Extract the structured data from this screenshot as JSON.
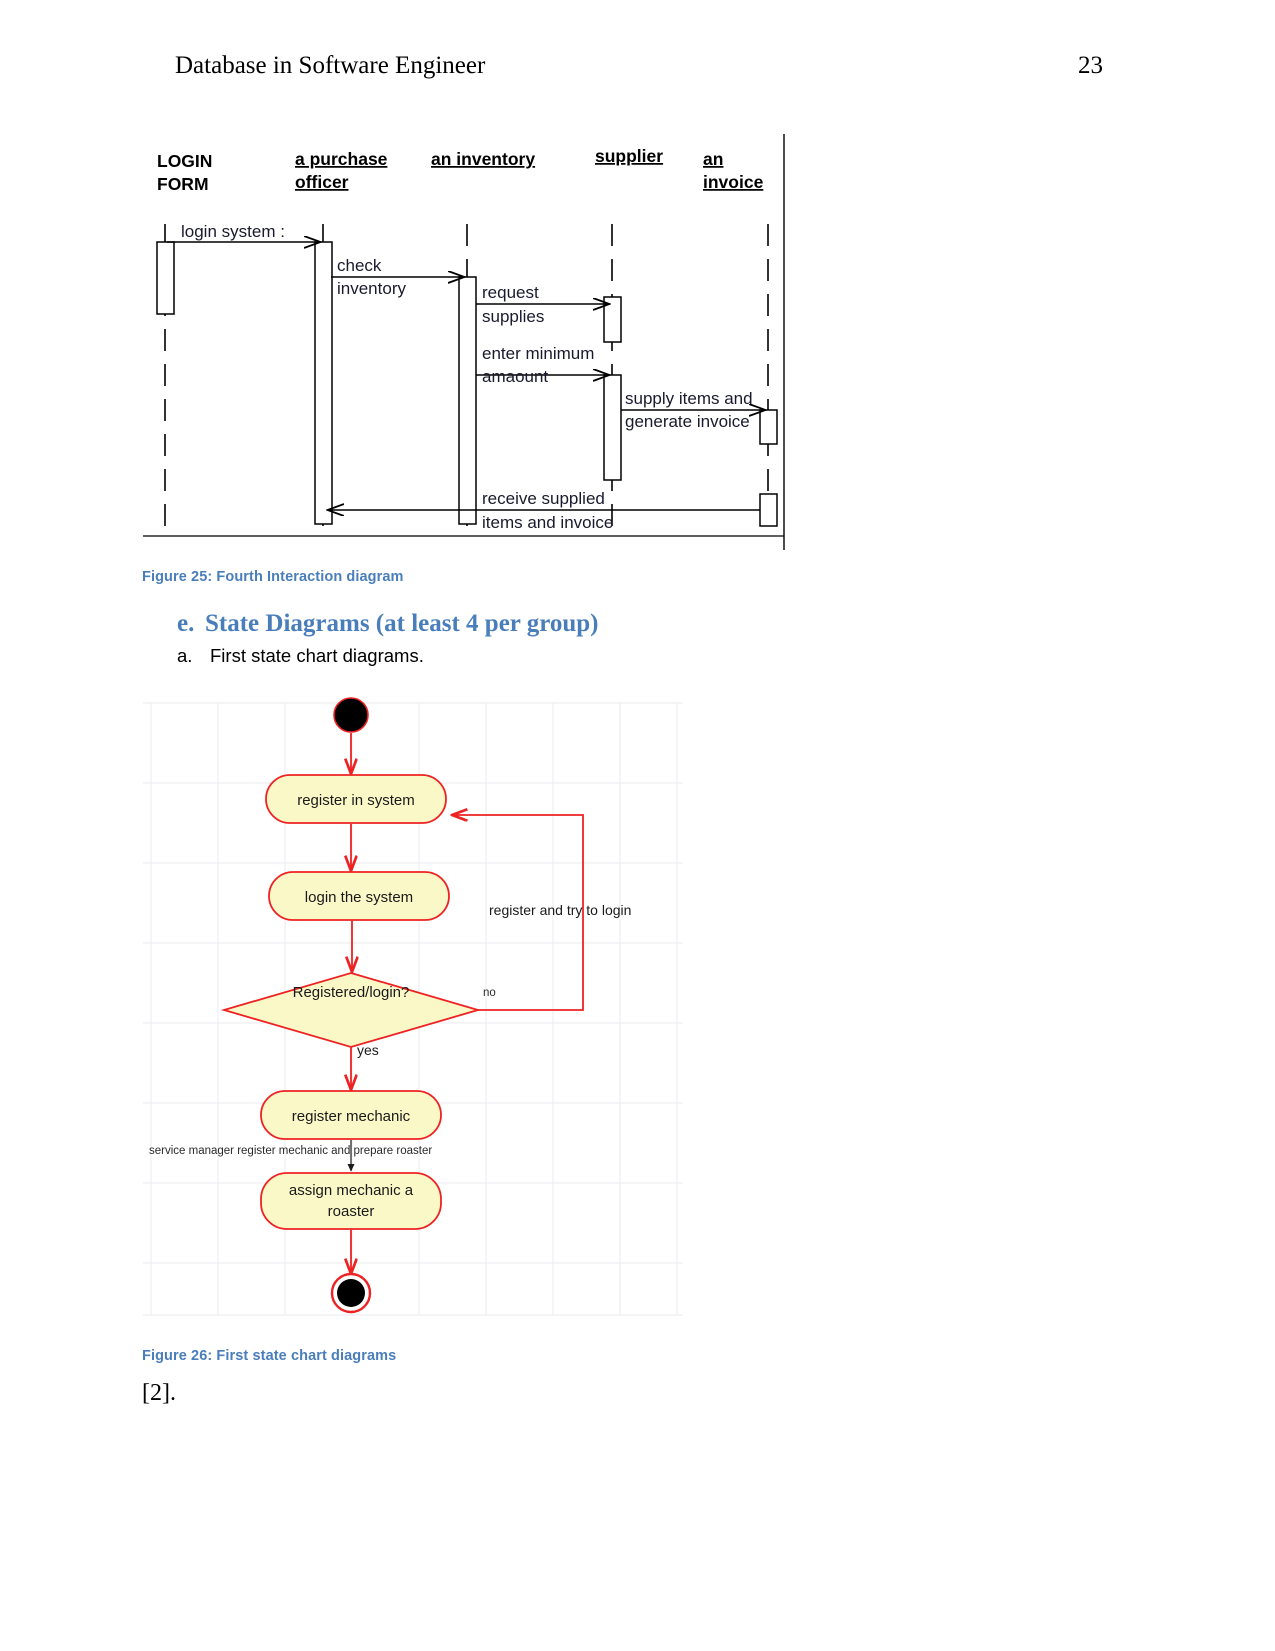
{
  "header": {
    "title": "Database in Software Engineer",
    "page_number": "23"
  },
  "sequence_diagram": {
    "caption": "Figure 25: Fourth Interaction diagram",
    "lifelines": [
      {
        "name": "login-form",
        "line1": "LOGIN",
        "line2": "FORM"
      },
      {
        "name": "purchase-officer",
        "line1": "a purchase ",
        "line2": "officer"
      },
      {
        "name": "inventory",
        "line1": "an inventory",
        "line2": ""
      },
      {
        "name": "supplier",
        "line1": "supplier",
        "line2": ""
      },
      {
        "name": "invoice",
        "line1": "an ",
        "line2": "invoice"
      }
    ],
    "messages": [
      {
        "name": "login-system",
        "line1": "login system :",
        "line2": ""
      },
      {
        "name": "check-inventory",
        "line1": "check",
        "line2": "inventory"
      },
      {
        "name": "request-supplies",
        "line1": "request",
        "line2": "supplies"
      },
      {
        "name": "enter-minimum-amount",
        "line1": "enter minimum",
        "line2": "amaount"
      },
      {
        "name": "supply-items-generate-invoice",
        "line1": "supply items and",
        "line2": "generate invoice"
      },
      {
        "name": "receive-supplied-items",
        "line1": "receive supplied",
        "line2": "items and invoice"
      }
    ]
  },
  "section": {
    "heading_marker": "e.",
    "heading_text": "State Diagrams (at least 4 per group)",
    "subitem_marker": "a.",
    "subitem_text": "First state chart diagrams."
  },
  "state_diagram": {
    "caption": "Figure 26: First state chart diagrams",
    "colors": {
      "node_fill": "#fbf8c8",
      "node_stroke": "#ee2222",
      "grid": "#e8e8ee",
      "initial_node": "#000000"
    },
    "nodes": [
      {
        "name": "initial-node",
        "type": "initial",
        "label": ""
      },
      {
        "name": "state-register-in-system",
        "type": "state",
        "label": "register in system"
      },
      {
        "name": "state-login-the-system",
        "type": "state",
        "label": "login the system"
      },
      {
        "name": "decision-registered-login",
        "type": "decision",
        "label": "Registered/login?"
      },
      {
        "name": "state-register-mechanic",
        "type": "state",
        "label": "register mechanic"
      },
      {
        "name": "state-assign-mechanic-roaster",
        "type": "state",
        "label_line1": "assign mechanic a",
        "label_line2": "roaster"
      },
      {
        "name": "final-node",
        "type": "final",
        "label": ""
      }
    ],
    "edge_labels": [
      {
        "name": "edge-label-no",
        "text": "no"
      },
      {
        "name": "edge-label-yes",
        "text": "yes"
      },
      {
        "name": "edge-label-register-retry",
        "text": "register and try to login"
      },
      {
        "name": "edge-label-service-manager",
        "text": "service manager register mechanic and prepare roaster"
      }
    ]
  },
  "footer": {
    "reference": "[2]."
  }
}
